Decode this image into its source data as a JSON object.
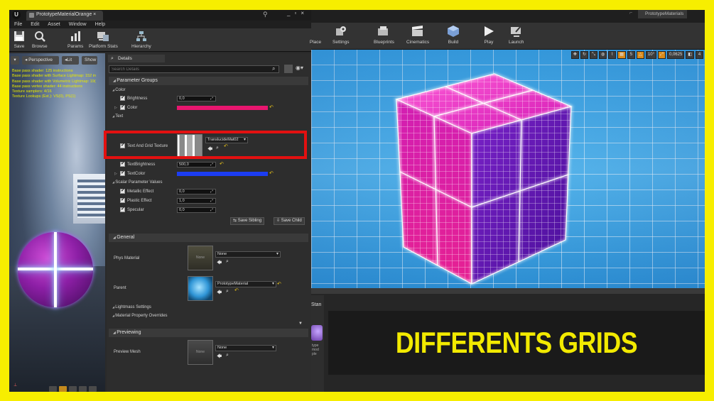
{
  "left_editor": {
    "doc_tab": "PrototypeMaterialOrange",
    "menus": [
      "File",
      "Edit",
      "Asset",
      "Window",
      "Help"
    ],
    "toolbar": [
      {
        "label": "Save",
        "icon": "save-icon"
      },
      {
        "label": "Browse",
        "icon": "browse-icon"
      },
      {
        "label": "Params",
        "icon": "params-icon"
      },
      {
        "label": "Platform Stats",
        "icon": "platform-stats-icon"
      },
      {
        "label": "Hierarchy",
        "icon": "hierarchy-icon"
      }
    ],
    "viewport": {
      "buttons": [
        "Perspective",
        "Lit",
        "Show"
      ],
      "stats": [
        "Base pass shader: 125 instructions",
        "Base pass shader with Surface Lightmap: 152 in",
        "Base pass shader with Volumetric Lightmap: 19(",
        "Base pass vertex shader: 44 instructions",
        "Texture samplers: 4/16",
        "Texture Lookups (Est.): VS(0), PS(1)"
      ]
    },
    "details": {
      "tab": "Details",
      "search_placeholder": "Search Details",
      "sections": {
        "parameter_groups": "Parameter Groups",
        "color": "Color",
        "text": "Text",
        "scalar": "Scalar Parameter Values",
        "general": "General",
        "previewing": "Previewing"
      },
      "brightness": {
        "label": "Brightness",
        "value": "0,0"
      },
      "color_param": {
        "label": "Color",
        "swatch": "#e8166f"
      },
      "text_grid": {
        "label": "Text And Grid Texture",
        "value": "TranslucideMat02"
      },
      "text_brightness": {
        "label": "TextBrightness",
        "value": "500,0"
      },
      "text_color": {
        "label": "TextColor",
        "swatch": "#1c3df2"
      },
      "metallic": {
        "label": "Metallic Effect",
        "value": "0,0"
      },
      "plastic": {
        "label": "Plastic Effect",
        "value": "1,0"
      },
      "specular": {
        "label": "Specular",
        "value": "0,0"
      },
      "save_sibling": "Save Sibling",
      "save_child": "Save Child",
      "phys_material": {
        "label": "Phys Material",
        "thumb": "None",
        "value": "None"
      },
      "parent": {
        "label": "Parent",
        "value": "PrototypeMaterial"
      },
      "lightmass": "Lightmass Settings",
      "overrides": "Material Property Overrides",
      "preview_mesh": {
        "label": "Preview Mesh",
        "thumb": "None",
        "value": "None"
      }
    }
  },
  "right_editor": {
    "tab": "PrototypeMaterials",
    "toolbar": [
      {
        "label": "Place",
        "icon": "place-icon"
      },
      {
        "label": "Settings",
        "icon": "settings-icon"
      },
      {
        "label": "Blueprints",
        "icon": "blueprints-icon"
      },
      {
        "label": "Cinematics",
        "icon": "cinematics-icon"
      },
      {
        "label": "Build",
        "icon": "build-icon"
      },
      {
        "label": "Play",
        "icon": "play-icon"
      },
      {
        "label": "Launch",
        "icon": "launch-icon"
      }
    ],
    "viewport_tools": {
      "grid": "5",
      "angle": "10°",
      "scale": "0,0625",
      "cam": "4"
    },
    "bottom_panel": {
      "tab": "Stan",
      "caption": "type\nmod\nple"
    },
    "banner": "DIFFERENTS GRIDS"
  },
  "colors": {
    "accent": "#f7ee00",
    "highlight": "#e31010",
    "pink": "#e8166f",
    "blue": "#1c3df2"
  }
}
